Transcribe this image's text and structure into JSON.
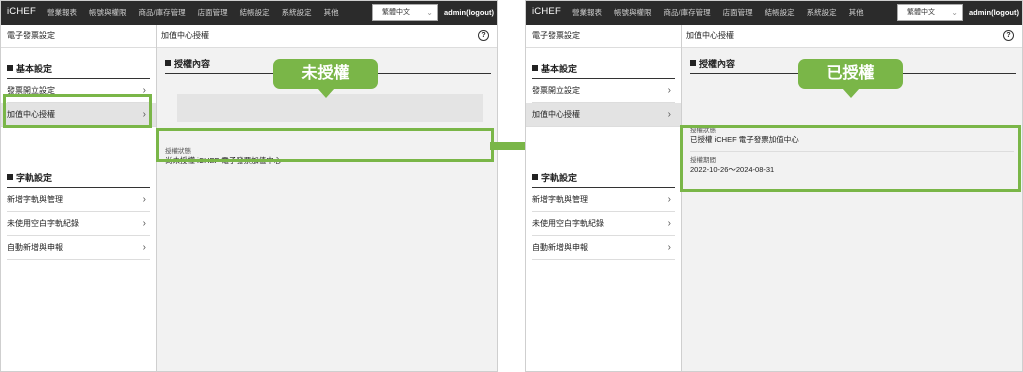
{
  "colors": {
    "highlight": "#7ab648",
    "topbar": "#2b2b2b"
  },
  "topbar": {
    "logo": "iCHEF",
    "nav": [
      "營業報表",
      "帳號與權限",
      "商品/庫存管理",
      "店面管理",
      "結帳設定",
      "系統設定",
      "其他"
    ],
    "language": "繁體中文",
    "user": "admin(logout)"
  },
  "sidebar": {
    "header": "電子發票設定",
    "group1": "基本設定",
    "items1": [
      "發票開立設定",
      "加值中心授權"
    ],
    "group2": "字軌設定",
    "items2": [
      "新增字軌與管理",
      "未使用空白字軌紀錄",
      "自動新增與申報"
    ]
  },
  "main": {
    "header": "加值中心授權",
    "section": "授權內容",
    "status_label": "授權狀態",
    "period_label": "授權期間"
  },
  "left": {
    "callout": "未授權",
    "status_value": "尚未授權 iCHEF 電子發票加值中心"
  },
  "right": {
    "callout": "已授權",
    "status_value": "已授權 iCHEF 電子發票加值中心",
    "period_value": "2022-10-26～2024-08-31"
  },
  "icons": {
    "help": "help-icon",
    "chevron": "chevron-right-icon",
    "caret": "caret-down-icon",
    "arrow": "arrow-right-icon"
  }
}
